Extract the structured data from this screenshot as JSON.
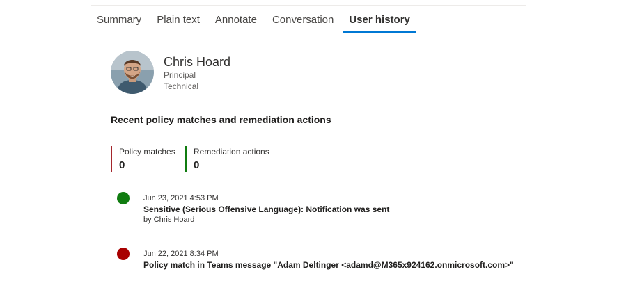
{
  "tabs": [
    {
      "label": "Summary",
      "active": false
    },
    {
      "label": "Plain text",
      "active": false
    },
    {
      "label": "Annotate",
      "active": false
    },
    {
      "label": "Conversation",
      "active": false
    },
    {
      "label": "User history",
      "active": true
    }
  ],
  "user": {
    "name": "Chris Hoard",
    "line1": "Principal",
    "line2": "Technical"
  },
  "section_title": "Recent policy matches and remediation actions",
  "stats": {
    "policy_matches": {
      "label": "Policy matches",
      "value": "0",
      "color": "#a4262c"
    },
    "remediation_actions": {
      "label": "Remediation actions",
      "value": "0",
      "color": "#107c10"
    }
  },
  "timeline": [
    {
      "date": "Jun 23, 2021 4:53 PM",
      "title": "Sensitive (Serious Offensive Language): Notification was sent",
      "by": "by Chris Hoard",
      "status_color": "#107c10"
    },
    {
      "date": "Jun 22, 2021 8:34 PM",
      "title": "Policy match in Teams message \"Adam Deltinger <adamd@M365x924162.onmicrosoft.com>\"",
      "status_color": "#a80000"
    }
  ],
  "colors": {
    "accent": "#0078d4"
  }
}
